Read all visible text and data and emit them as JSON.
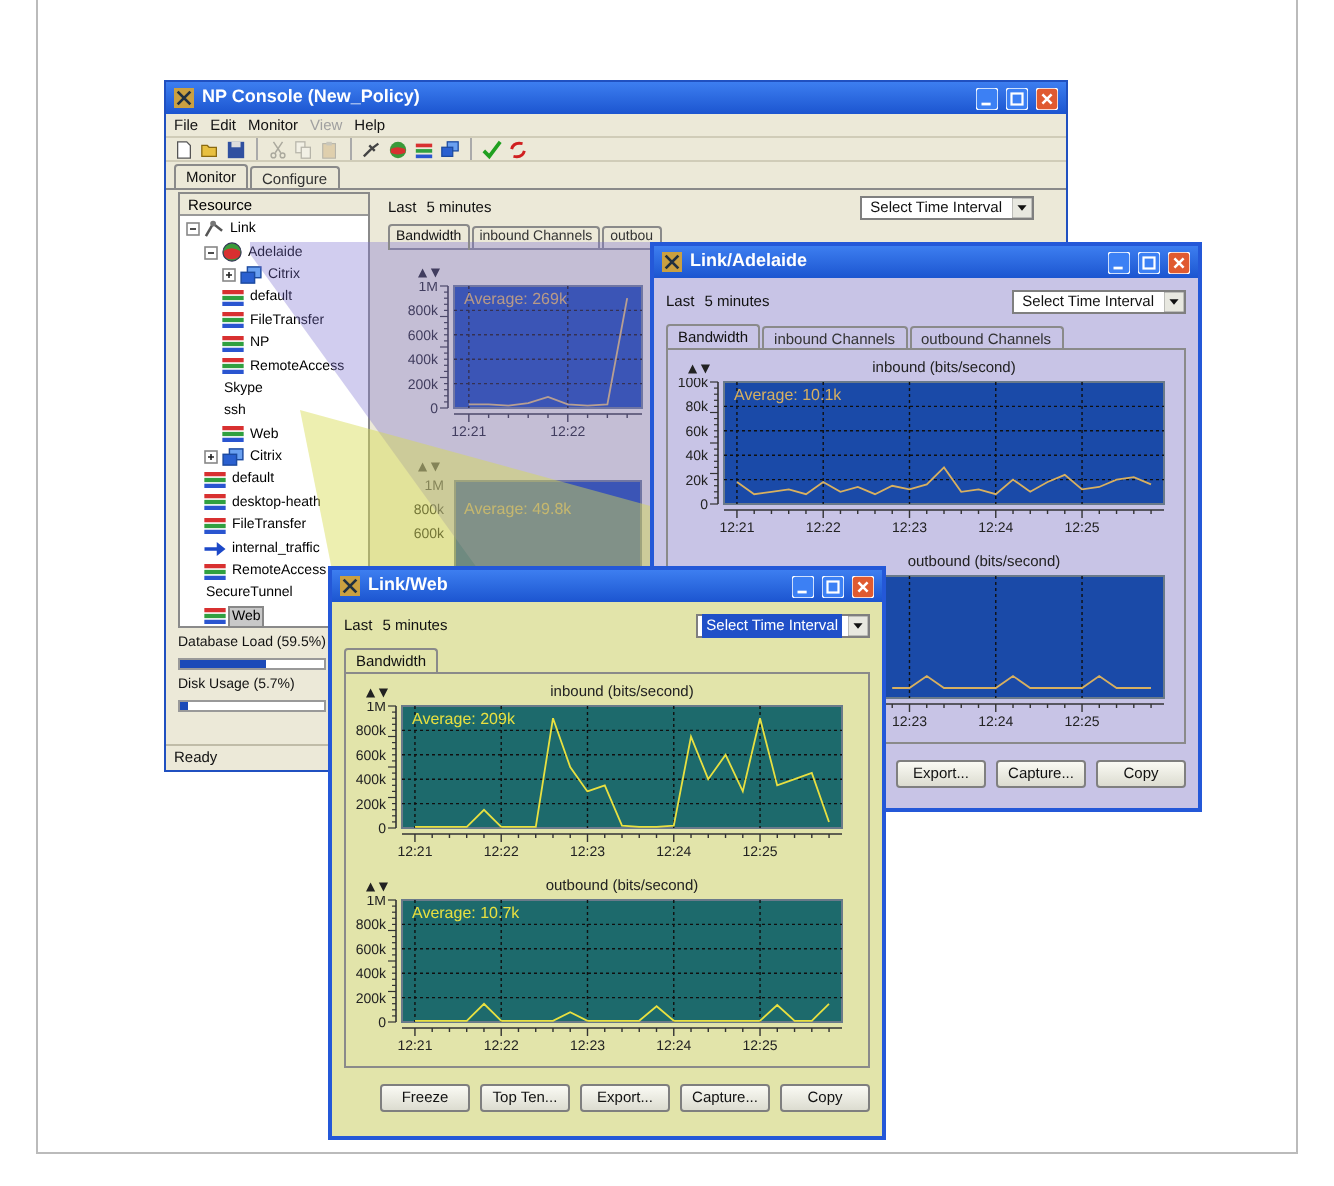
{
  "main_window": {
    "title": "NP Console (New_Policy)",
    "menu": [
      {
        "label": "File",
        "disabled": false
      },
      {
        "label": "Edit",
        "disabled": false
      },
      {
        "label": "Monitor",
        "disabled": false
      },
      {
        "label": "View",
        "disabled": true
      },
      {
        "label": "Help",
        "disabled": false
      }
    ],
    "toolbar": [
      {
        "kind": "new",
        "disabled": false
      },
      {
        "kind": "open",
        "disabled": false
      },
      {
        "kind": "save",
        "disabled": false
      },
      {
        "kind": "separator"
      },
      {
        "kind": "cut",
        "disabled": true
      },
      {
        "kind": "copy",
        "disabled": true
      },
      {
        "kind": "paste",
        "disabled": true
      },
      {
        "kind": "separator"
      },
      {
        "kind": "probe",
        "disabled": false
      },
      {
        "kind": "site",
        "disabled": false
      },
      {
        "kind": "class",
        "disabled": false
      },
      {
        "kind": "group",
        "disabled": false
      },
      {
        "kind": "separator"
      },
      {
        "kind": "apply",
        "disabled": false
      },
      {
        "kind": "refresh",
        "disabled": false
      }
    ],
    "tabs": [
      {
        "label": "Monitor",
        "selected": true
      },
      {
        "label": "Configure",
        "selected": false
      }
    ],
    "tree": {
      "header": "Resource",
      "items": [
        {
          "label": "Link",
          "kind": "link",
          "expanded": true,
          "selected": false,
          "children": [
            {
              "label": "Adelaide",
              "kind": "site",
              "expanded": true,
              "selected": false,
              "children": [
                {
                  "label": "Citrix",
                  "kind": "group",
                  "expanded": false,
                  "selected": false
                },
                {
                  "label": "default",
                  "kind": "class",
                  "selected": false
                },
                {
                  "label": "FileTransfer",
                  "kind": "class",
                  "selected": false
                },
                {
                  "label": "NP",
                  "kind": "class",
                  "selected": false
                },
                {
                  "label": "RemoteAccess",
                  "kind": "class",
                  "selected": false
                },
                {
                  "label": "Skype",
                  "kind": "plain",
                  "selected": false
                },
                {
                  "label": "ssh",
                  "kind": "plain",
                  "selected": false
                },
                {
                  "label": "Web",
                  "kind": "class",
                  "selected": false
                }
              ]
            },
            {
              "label": "Citrix",
              "kind": "group",
              "expanded": false,
              "selected": false
            },
            {
              "label": "default",
              "kind": "class",
              "selected": false
            },
            {
              "label": "desktop-heath",
              "kind": "class",
              "selected": false
            },
            {
              "label": "FileTransfer",
              "kind": "class",
              "selected": false
            },
            {
              "label": "internal_traffic",
              "kind": "arrow",
              "selected": false
            },
            {
              "label": "RemoteAccess",
              "kind": "class",
              "selected": false
            },
            {
              "label": "SecureTunnel",
              "kind": "plain",
              "selected": false
            },
            {
              "label": "Web",
              "kind": "class",
              "selected": true
            }
          ]
        }
      ]
    },
    "meters": [
      {
        "label": "Database Load (59.5%)",
        "level": 0.595
      },
      {
        "label": "Disk Usage (5.7%)",
        "level": 0.057
      }
    ],
    "status_bar": "Ready",
    "interval": {
      "label": "Last",
      "value": "5 minutes"
    },
    "dropdown": {
      "value": "Select Time Interval"
    },
    "view_tabs": [
      {
        "label": "Bandwidth",
        "selected": true
      },
      {
        "label": "inbound Channels",
        "selected": false
      },
      {
        "label": "outbou",
        "selected": false
      }
    ],
    "charts": [
      {
        "average": "Average: 269k",
        "chart_data": {
          "type": "line",
          "grid": true,
          "categories": [
            "12:21",
            null,
            null,
            null,
            null,
            "12:22",
            null,
            null,
            null
          ],
          "ylim": [
            0,
            1000000
          ],
          "yticks": [
            {
              "value": 0,
              "label": "0"
            },
            {
              "value": 200000,
              "label": "200k"
            },
            {
              "value": 400000,
              "label": "400k"
            },
            {
              "value": 600000,
              "label": "600k"
            },
            {
              "value": 800000,
              "label": "800k"
            },
            {
              "value": 1000000,
              "label": "1M"
            }
          ],
          "series": [
            {
              "color": "#d8b870",
              "values": [
                30000,
                30000,
                20000,
                40000,
                90000,
                30000,
                20000,
                30000,
                900000
              ]
            }
          ]
        }
      },
      {
        "average": "Average: 49.8k",
        "y_labels": [
          "1M",
          "800k",
          "600k"
        ]
      }
    ]
  },
  "adelaide_window": {
    "title": "Link/Adelaide",
    "interval": {
      "label": "Last",
      "value": "5 minutes"
    },
    "dropdown": {
      "value": "Select Time Interval",
      "focused": false
    },
    "tabs": [
      {
        "label": "Bandwidth",
        "selected": true
      },
      {
        "label": "inbound Channels",
        "selected": false
      },
      {
        "label": "outbound Channels",
        "selected": false
      }
    ],
    "charts": [
      {
        "average": "Average: 10.1k",
        "chart_data": {
          "type": "line",
          "grid": true,
          "title": "inbound (bits/second)",
          "categories": [
            "12:21",
            null,
            null,
            null,
            null,
            "12:22",
            null,
            null,
            null,
            null,
            "12:23",
            null,
            null,
            null,
            null,
            "12:24",
            null,
            null,
            null,
            null,
            "12:25",
            null,
            null,
            null,
            null
          ],
          "ylim": [
            0,
            100000
          ],
          "yticks": [
            {
              "value": 0,
              "label": "0"
            },
            {
              "value": 20000,
              "label": "20k"
            },
            {
              "value": 40000,
              "label": "40k"
            },
            {
              "value": 60000,
              "label": "60k"
            },
            {
              "value": 80000,
              "label": "80k"
            },
            {
              "value": 100000,
              "label": "100k"
            }
          ],
          "series": [
            {
              "color": "#d8b060",
              "values": [
                18000,
                8000,
                10000,
                12000,
                8000,
                18000,
                10000,
                14000,
                8000,
                15000,
                12000,
                16000,
                30000,
                10000,
                12000,
                8000,
                20000,
                10000,
                18000,
                24000,
                12000,
                14000,
                20000,
                22000,
                16000
              ]
            }
          ]
        }
      },
      {
        "title": "outbound (bits/second)",
        "x_labels": [
          "12:23",
          "12:24",
          "12:25"
        ]
      }
    ],
    "buttons": [
      "Export...",
      "Capture...",
      "Copy"
    ]
  },
  "web_window": {
    "title": "Link/Web",
    "interval": {
      "label": "Last",
      "value": "5 minutes"
    },
    "dropdown": {
      "value": "Select Time Interval",
      "focused": true
    },
    "tabs": [
      {
        "label": "Bandwidth",
        "selected": true
      }
    ],
    "charts": [
      {
        "average": "Average: 209k",
        "chart_data": {
          "type": "line",
          "grid": true,
          "title": "inbound (bits/second)",
          "categories": [
            "12:21",
            null,
            null,
            null,
            null,
            "12:22",
            null,
            null,
            null,
            null,
            "12:23",
            null,
            null,
            null,
            null,
            "12:24",
            null,
            null,
            null,
            null,
            "12:25",
            null,
            null,
            null,
            null
          ],
          "ylim": [
            0,
            1000000
          ],
          "yticks": [
            {
              "value": 0,
              "label": "0"
            },
            {
              "value": 200000,
              "label": "200k"
            },
            {
              "value": 400000,
              "label": "400k"
            },
            {
              "value": 600000,
              "label": "600k"
            },
            {
              "value": 800000,
              "label": "800k"
            },
            {
              "value": 1000000,
              "label": "1M"
            }
          ],
          "series": [
            {
              "color": "#e8e040",
              "values": [
                10000,
                10000,
                10000,
                10000,
                150000,
                10000,
                10000,
                10000,
                900000,
                500000,
                300000,
                350000,
                20000,
                10000,
                10000,
                20000,
                750000,
                400000,
                600000,
                300000,
                900000,
                350000,
                400000,
                450000,
                50000
              ]
            }
          ]
        }
      },
      {
        "average": "Average: 10.7k",
        "chart_data": {
          "type": "line",
          "grid": true,
          "title": "outbound (bits/second)",
          "categories": [
            "12:21",
            null,
            null,
            null,
            null,
            "12:22",
            null,
            null,
            null,
            null,
            "12:23",
            null,
            null,
            null,
            null,
            "12:24",
            null,
            null,
            null,
            null,
            "12:25",
            null,
            null,
            null,
            null
          ],
          "ylim": [
            0,
            1000000
          ],
          "yticks": [
            {
              "value": 0,
              "label": "0"
            },
            {
              "value": 200000,
              "label": "200k"
            },
            {
              "value": 400000,
              "label": "400k"
            },
            {
              "value": 600000,
              "label": "600k"
            },
            {
              "value": 800000,
              "label": "800k"
            },
            {
              "value": 1000000,
              "label": "1M"
            }
          ],
          "series": [
            {
              "color": "#e8e040",
              "values": [
                10000,
                10000,
                10000,
                10000,
                150000,
                10000,
                10000,
                10000,
                10000,
                80000,
                10000,
                10000,
                10000,
                10000,
                130000,
                10000,
                10000,
                10000,
                10000,
                10000,
                10000,
                140000,
                10000,
                10000,
                150000
              ]
            }
          ]
        }
      }
    ],
    "buttons": [
      "Freeze",
      "Top Ten...",
      "Export...",
      "Capture...",
      "Copy"
    ]
  }
}
